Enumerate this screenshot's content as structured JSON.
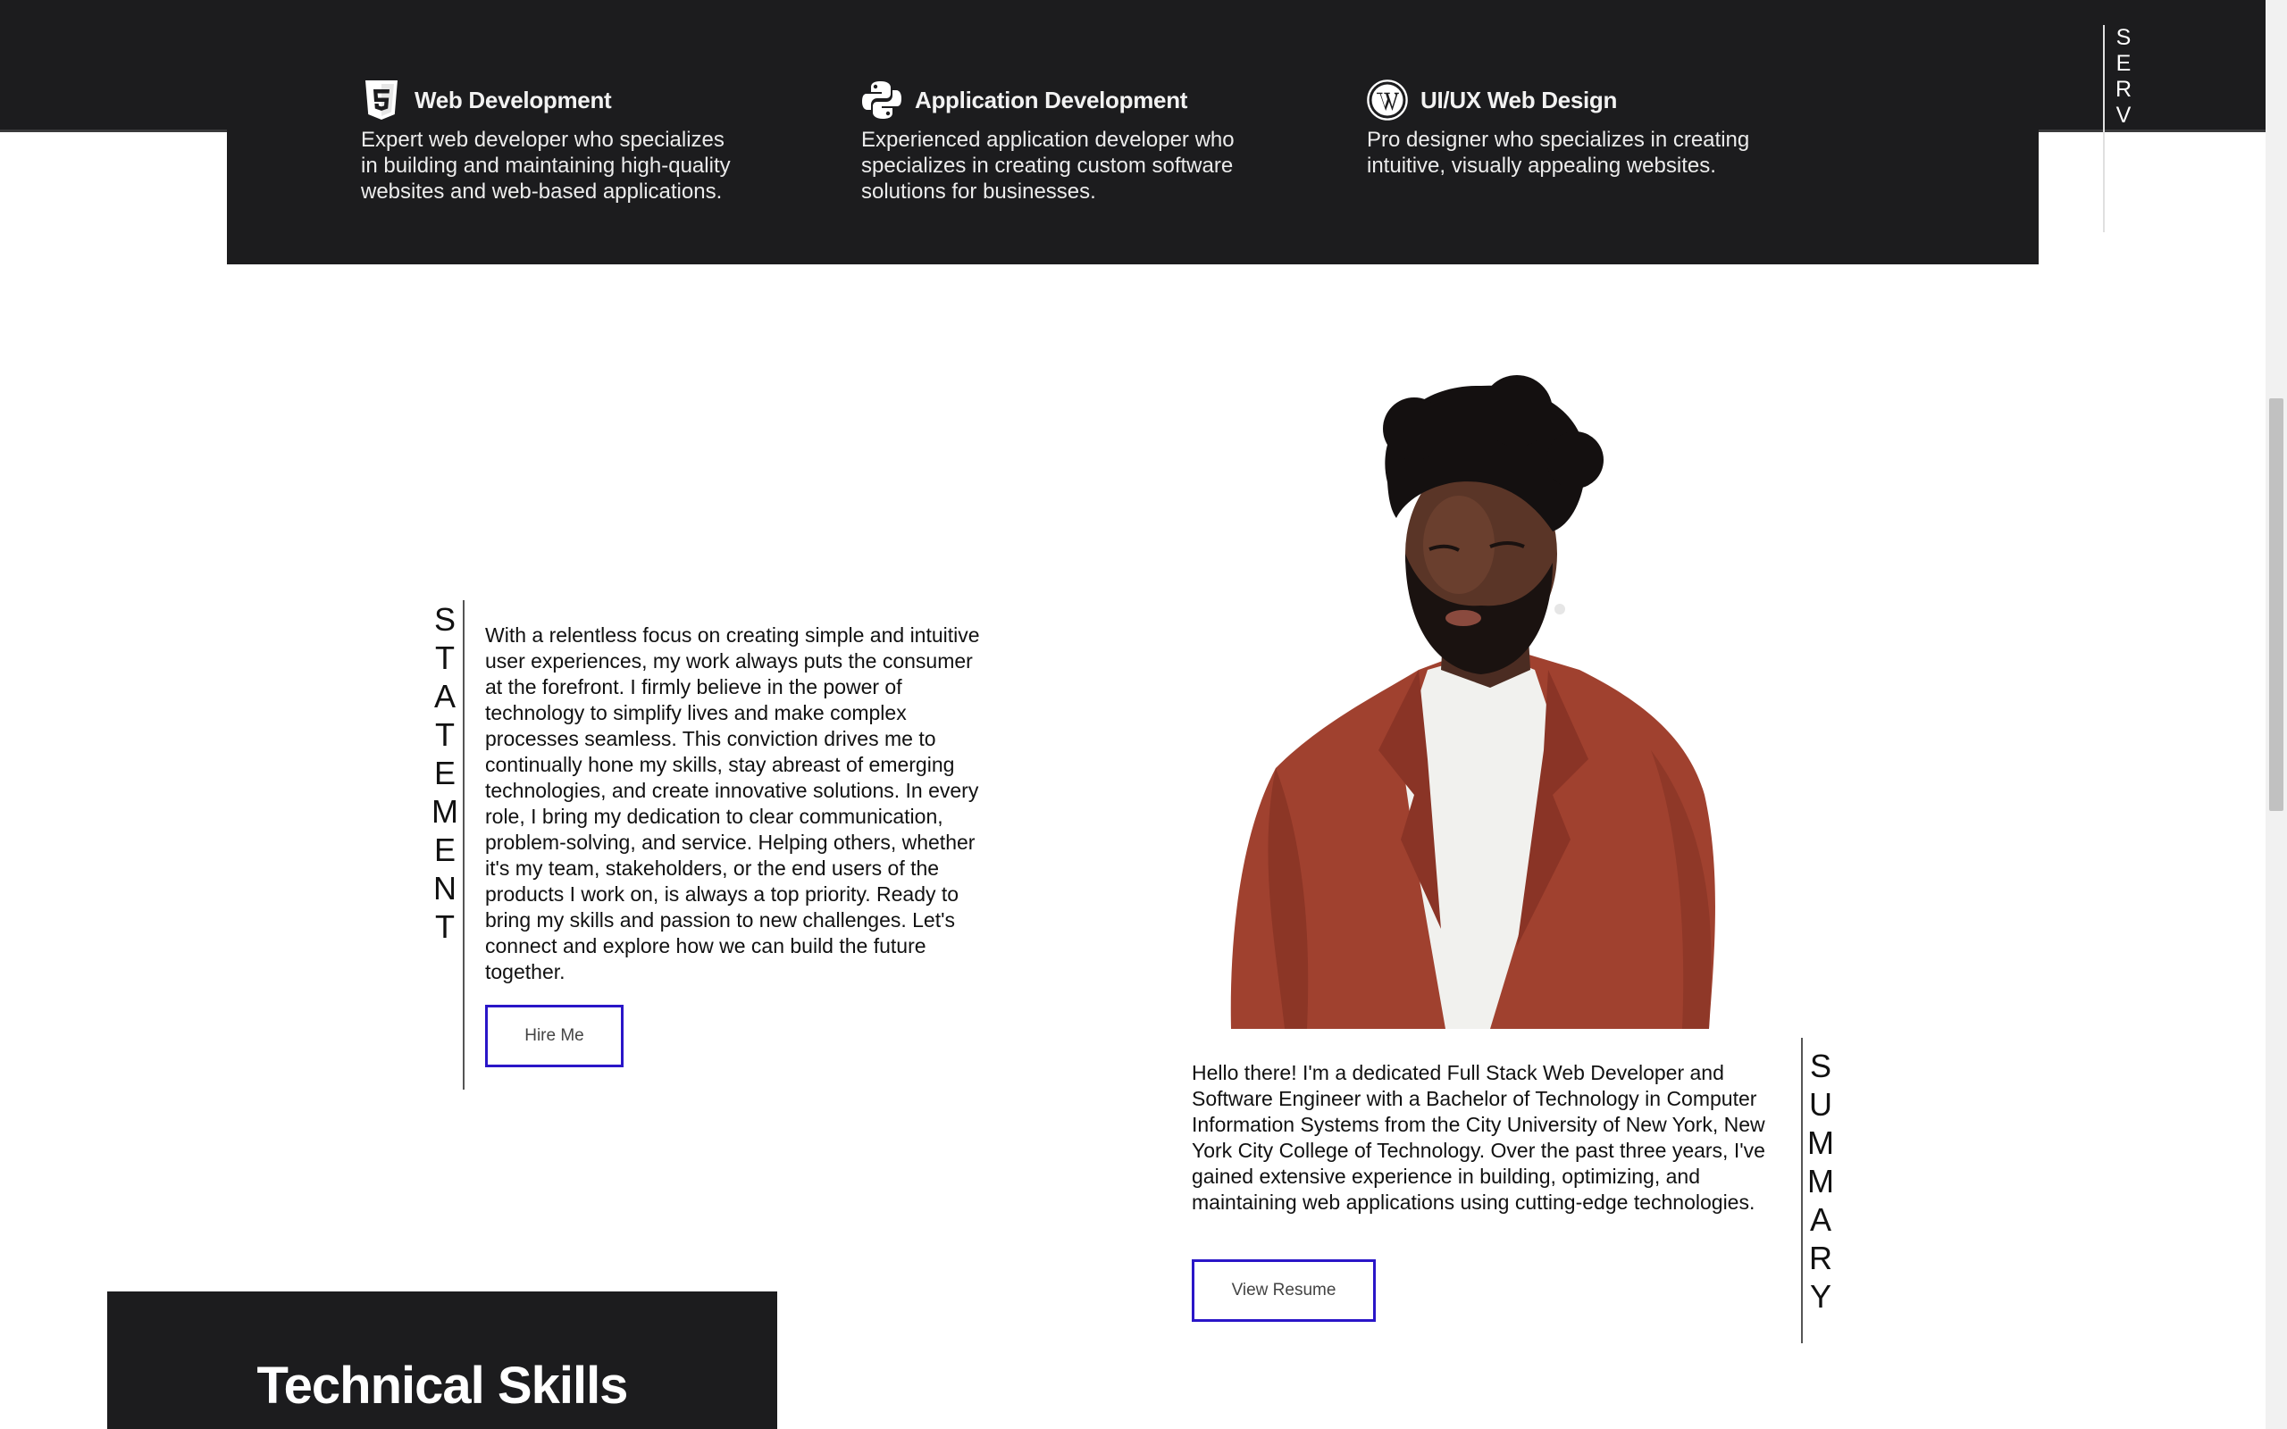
{
  "services": {
    "vertical_label": "SERVICES",
    "items": [
      {
        "icon": "html5-icon",
        "title": "Web Development",
        "description": "Expert web developer who specializes in building and maintaining high-quality websites and web-based applications."
      },
      {
        "icon": "python-icon",
        "title": "Application Development",
        "description": "Experienced application developer who specializes in creating custom software solutions for businesses."
      },
      {
        "icon": "wordpress-icon",
        "title": "UI/UX Web Design",
        "description": "Pro designer who specializes in creating intuitive, visually appealing websites."
      }
    ]
  },
  "statement": {
    "vertical_label": "STATEMENT",
    "text": "With a relentless focus on creating simple and intuitive user experiences, my work always puts the consumer at the forefront. I firmly believe in the power of technology to simplify lives and make complex processes seamless. This conviction drives me to continually hone my skills, stay abreast of emerging technologies, and create innovative solutions. In every role, I bring my dedication to clear communication, problem-solving, and service. Helping others, whether it's my team, stakeholders, or the end users of the products I work on, is always a top priority. Ready to bring my skills and passion to new challenges. Let's connect and explore how we can build the future together.",
    "button_label": "Hire Me"
  },
  "summary": {
    "vertical_label": "SUMMARY",
    "text": "Hello there! I'm a dedicated Full Stack Web Developer and Software Engineer with a Bachelor of Technology in Computer Information Systems from the City University of New York, New York City College of Technology. Over the past three years, I've gained extensive experience in building, optimizing, and maintaining web applications using cutting-edge technologies.",
    "button_label": "View Resume"
  },
  "skills": {
    "title": "Technical Skills"
  },
  "colors": {
    "dark_panel": "#1c1c1e",
    "button_border": "#2a16c8",
    "jacket": "#a0412f"
  }
}
